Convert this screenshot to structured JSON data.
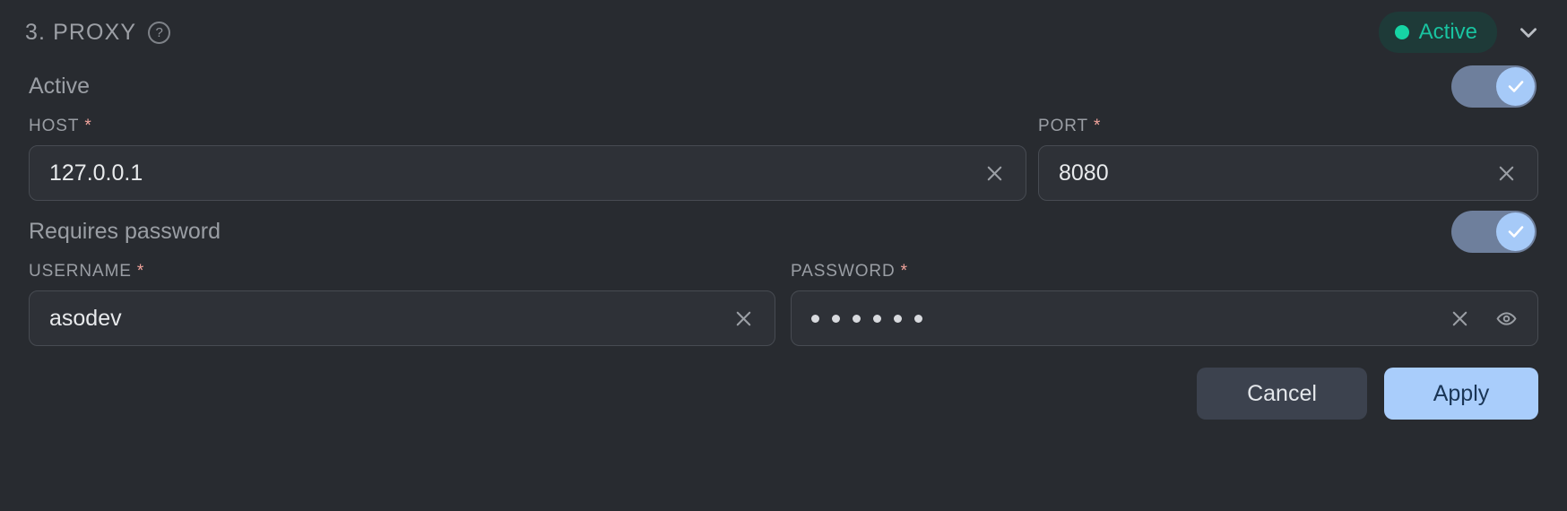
{
  "header": {
    "title": "3. PROXY",
    "help_icon": "help-circle-icon",
    "status_label": "Active",
    "status_color": "#16d4a4",
    "badge_bg": "#1e3a38",
    "collapse_icon": "chevron-down-icon"
  },
  "active_toggle": {
    "label": "Active",
    "state": "on",
    "track_color": "#6e7f9c",
    "knob_color": "#a6caf8"
  },
  "password_toggle": {
    "label": "Requires password",
    "state": "on",
    "track_color": "#6e7f9c",
    "knob_color": "#a6caf8"
  },
  "fields": {
    "host": {
      "label": "HOST",
      "required_marker": "*",
      "value": "127.0.0.1",
      "clear_icon": "close-icon"
    },
    "port": {
      "label": "PORT",
      "required_marker": "*",
      "value": "8080",
      "clear_icon": "close-icon"
    },
    "username": {
      "label": "USERNAME",
      "required_marker": "*",
      "value": "asodev",
      "clear_icon": "close-icon"
    },
    "password": {
      "label": "PASSWORD",
      "required_marker": "*",
      "masked_char_count": 6,
      "clear_icon": "close-icon",
      "reveal_icon": "eye-icon"
    }
  },
  "actions": {
    "cancel_label": "Cancel",
    "apply_label": "Apply",
    "cancel_bg": "#3c424e",
    "apply_bg": "#a9cdfb"
  },
  "theme": {
    "background": "#282b30",
    "input_bg": "#2e3137",
    "input_border": "#474b52",
    "label_color": "#9a9ea4",
    "required_color": "#f2a49c"
  }
}
